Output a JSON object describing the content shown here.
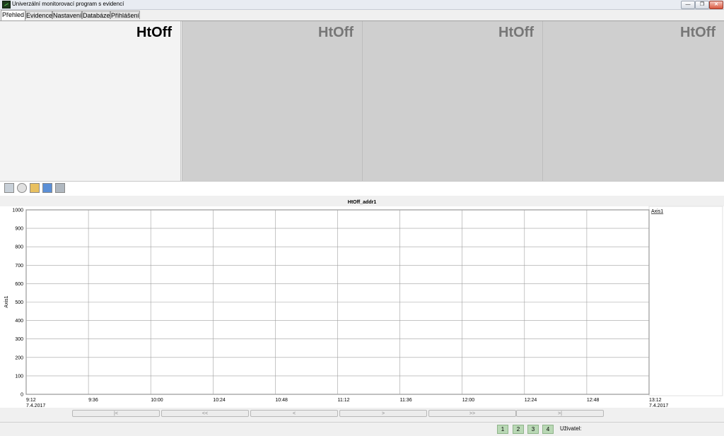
{
  "window": {
    "title": "Univerzální monitorovací program s evidencí",
    "buttons": [
      "—",
      "❐",
      "✕"
    ]
  },
  "tabs": [
    {
      "label": "Přehled",
      "active": true
    },
    {
      "label": "Evidence",
      "active": false
    },
    {
      "label": "Nastavení",
      "active": false
    },
    {
      "label": "Databáze",
      "active": false
    },
    {
      "label": "Přihlášení",
      "active": false
    }
  ],
  "panels": [
    {
      "title": "HtOff"
    },
    {
      "title": "HtOff"
    },
    {
      "title": "HtOff"
    },
    {
      "title": "HtOff"
    }
  ],
  "toolbar": {
    "icons": [
      "table-icon",
      "gauge-icon",
      "book-icon",
      "folder-icon",
      "printer-icon"
    ],
    "colors": [
      "#c8d0d8",
      "#e0e0e0",
      "#e8c060",
      "#5b8fd6",
      "#b0b8c0"
    ]
  },
  "chart_data": {
    "type": "line",
    "title": "HtOff_addr1",
    "ylabel": "Axis1",
    "legend": [
      "Axis1"
    ],
    "legend_position": "right",
    "ylim": [
      0,
      1000
    ],
    "yticks": [
      0,
      100,
      200,
      300,
      400,
      500,
      600,
      700,
      800,
      900,
      1000
    ],
    "xticks": [
      {
        "time": "9:12",
        "date": "7.4.2017"
      },
      {
        "time": "9:36",
        "date": ""
      },
      {
        "time": "10:00",
        "date": ""
      },
      {
        "time": "10:24",
        "date": ""
      },
      {
        "time": "10:48",
        "date": ""
      },
      {
        "time": "11:12",
        "date": ""
      },
      {
        "time": "11:36",
        "date": ""
      },
      {
        "time": "12:00",
        "date": ""
      },
      {
        "time": "12:24",
        "date": ""
      },
      {
        "time": "12:48",
        "date": ""
      },
      {
        "time": "13:12",
        "date": "7.4.2017"
      }
    ],
    "grid": true,
    "series": []
  },
  "navigation": [
    "|<",
    "<<",
    "<",
    ">",
    ">>",
    ">|"
  ],
  "statusbar": {
    "pages": [
      "1",
      "2",
      "3",
      "4"
    ],
    "user_label": "Uživatel:"
  }
}
